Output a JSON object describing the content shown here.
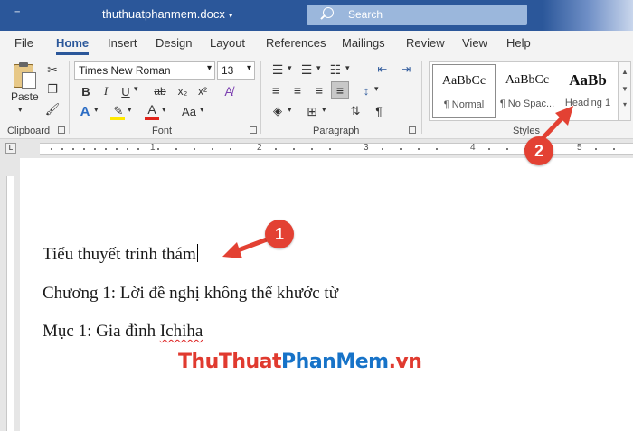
{
  "titlebar": {
    "qat_label": "=",
    "document_name": "thuthuatphanmem.docx",
    "document_caret": "▾",
    "search_placeholder": "Search"
  },
  "tabs": [
    {
      "label": "File",
      "active": false
    },
    {
      "label": "Home",
      "active": true
    },
    {
      "label": "Insert",
      "active": false
    },
    {
      "label": "Design",
      "active": false
    },
    {
      "label": "Layout",
      "active": false
    },
    {
      "label": "References",
      "active": false
    },
    {
      "label": "Mailings",
      "active": false
    },
    {
      "label": "Review",
      "active": false
    },
    {
      "label": "View",
      "active": false
    },
    {
      "label": "Help",
      "active": false
    }
  ],
  "ribbon": {
    "clipboard": {
      "group_label": "Clipboard",
      "paste_label": "Paste"
    },
    "font": {
      "group_label": "Font",
      "font_name": "Times New Roman",
      "font_size": "13",
      "buttons": [
        "B",
        "I",
        "U",
        "ab",
        "x₂",
        "x²",
        "A",
        "A",
        "Aa"
      ]
    },
    "paragraph": {
      "group_label": "Paragraph"
    },
    "styles": {
      "group_label": "Styles",
      "items": [
        {
          "sample": "AaBbCc",
          "name": "¶ Normal"
        },
        {
          "sample": "AaBbCc",
          "name": "¶ No Spac..."
        },
        {
          "sample": "AaBb",
          "name": "Heading 1"
        }
      ]
    }
  },
  "ruler": {
    "numbers": [
      "1",
      "2",
      "3",
      "4",
      "5"
    ]
  },
  "document": {
    "lines": [
      "Tiểu thuyết trinh thám",
      "Chương 1: Lời đề nghị không thể khước từ",
      "Mục 1: Gia đình "
    ],
    "misspelled_word": "Ichiha"
  },
  "watermark": {
    "part1": "ThuThuat",
    "part2": "PhanMem",
    "part3": ".vn"
  },
  "callouts": [
    {
      "number": "1"
    },
    {
      "number": "2"
    }
  ],
  "colors": {
    "titlebar": "#2b579a",
    "callout": "#e34133",
    "highlight_yellow": "#ffe800",
    "font_red": "#e0241b"
  }
}
